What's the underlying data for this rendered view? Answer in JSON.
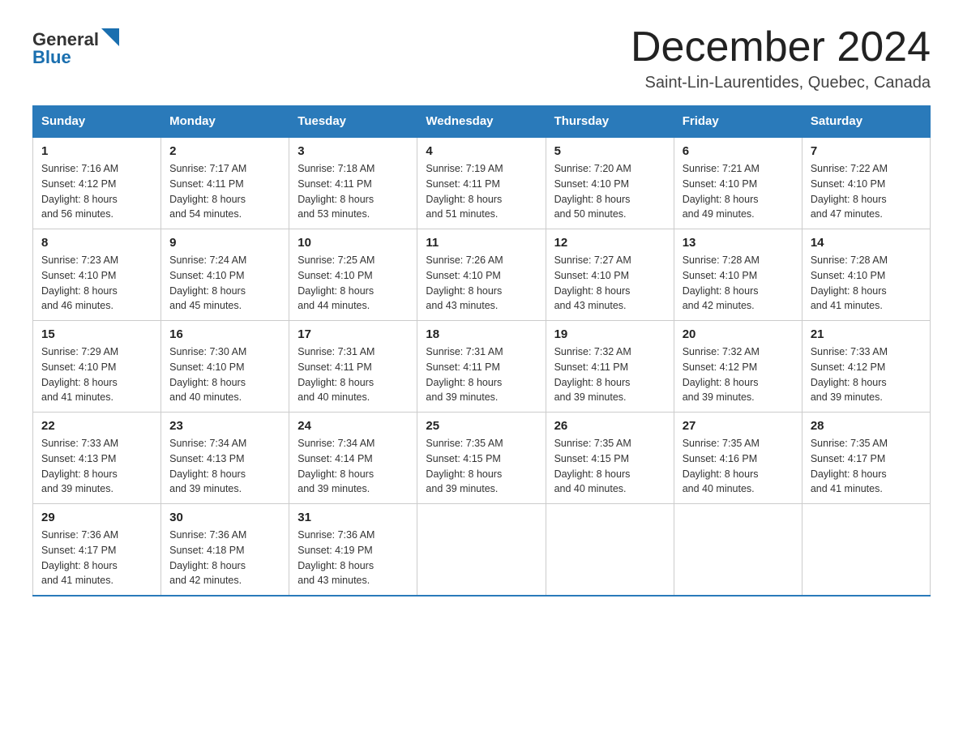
{
  "header": {
    "logo_general": "General",
    "logo_blue": "Blue",
    "title": "December 2024",
    "subtitle": "Saint-Lin-Laurentides, Quebec, Canada"
  },
  "calendar": {
    "days_of_week": [
      "Sunday",
      "Monday",
      "Tuesday",
      "Wednesday",
      "Thursday",
      "Friday",
      "Saturday"
    ],
    "weeks": [
      [
        {
          "day": "1",
          "sunrise": "Sunrise: 7:16 AM",
          "sunset": "Sunset: 4:12 PM",
          "daylight": "Daylight: 8 hours",
          "daylight2": "and 56 minutes."
        },
        {
          "day": "2",
          "sunrise": "Sunrise: 7:17 AM",
          "sunset": "Sunset: 4:11 PM",
          "daylight": "Daylight: 8 hours",
          "daylight2": "and 54 minutes."
        },
        {
          "day": "3",
          "sunrise": "Sunrise: 7:18 AM",
          "sunset": "Sunset: 4:11 PM",
          "daylight": "Daylight: 8 hours",
          "daylight2": "and 53 minutes."
        },
        {
          "day": "4",
          "sunrise": "Sunrise: 7:19 AM",
          "sunset": "Sunset: 4:11 PM",
          "daylight": "Daylight: 8 hours",
          "daylight2": "and 51 minutes."
        },
        {
          "day": "5",
          "sunrise": "Sunrise: 7:20 AM",
          "sunset": "Sunset: 4:10 PM",
          "daylight": "Daylight: 8 hours",
          "daylight2": "and 50 minutes."
        },
        {
          "day": "6",
          "sunrise": "Sunrise: 7:21 AM",
          "sunset": "Sunset: 4:10 PM",
          "daylight": "Daylight: 8 hours",
          "daylight2": "and 49 minutes."
        },
        {
          "day": "7",
          "sunrise": "Sunrise: 7:22 AM",
          "sunset": "Sunset: 4:10 PM",
          "daylight": "Daylight: 8 hours",
          "daylight2": "and 47 minutes."
        }
      ],
      [
        {
          "day": "8",
          "sunrise": "Sunrise: 7:23 AM",
          "sunset": "Sunset: 4:10 PM",
          "daylight": "Daylight: 8 hours",
          "daylight2": "and 46 minutes."
        },
        {
          "day": "9",
          "sunrise": "Sunrise: 7:24 AM",
          "sunset": "Sunset: 4:10 PM",
          "daylight": "Daylight: 8 hours",
          "daylight2": "and 45 minutes."
        },
        {
          "day": "10",
          "sunrise": "Sunrise: 7:25 AM",
          "sunset": "Sunset: 4:10 PM",
          "daylight": "Daylight: 8 hours",
          "daylight2": "and 44 minutes."
        },
        {
          "day": "11",
          "sunrise": "Sunrise: 7:26 AM",
          "sunset": "Sunset: 4:10 PM",
          "daylight": "Daylight: 8 hours",
          "daylight2": "and 43 minutes."
        },
        {
          "day": "12",
          "sunrise": "Sunrise: 7:27 AM",
          "sunset": "Sunset: 4:10 PM",
          "daylight": "Daylight: 8 hours",
          "daylight2": "and 43 minutes."
        },
        {
          "day": "13",
          "sunrise": "Sunrise: 7:28 AM",
          "sunset": "Sunset: 4:10 PM",
          "daylight": "Daylight: 8 hours",
          "daylight2": "and 42 minutes."
        },
        {
          "day": "14",
          "sunrise": "Sunrise: 7:28 AM",
          "sunset": "Sunset: 4:10 PM",
          "daylight": "Daylight: 8 hours",
          "daylight2": "and 41 minutes."
        }
      ],
      [
        {
          "day": "15",
          "sunrise": "Sunrise: 7:29 AM",
          "sunset": "Sunset: 4:10 PM",
          "daylight": "Daylight: 8 hours",
          "daylight2": "and 41 minutes."
        },
        {
          "day": "16",
          "sunrise": "Sunrise: 7:30 AM",
          "sunset": "Sunset: 4:10 PM",
          "daylight": "Daylight: 8 hours",
          "daylight2": "and 40 minutes."
        },
        {
          "day": "17",
          "sunrise": "Sunrise: 7:31 AM",
          "sunset": "Sunset: 4:11 PM",
          "daylight": "Daylight: 8 hours",
          "daylight2": "and 40 minutes."
        },
        {
          "day": "18",
          "sunrise": "Sunrise: 7:31 AM",
          "sunset": "Sunset: 4:11 PM",
          "daylight": "Daylight: 8 hours",
          "daylight2": "and 39 minutes."
        },
        {
          "day": "19",
          "sunrise": "Sunrise: 7:32 AM",
          "sunset": "Sunset: 4:11 PM",
          "daylight": "Daylight: 8 hours",
          "daylight2": "and 39 minutes."
        },
        {
          "day": "20",
          "sunrise": "Sunrise: 7:32 AM",
          "sunset": "Sunset: 4:12 PM",
          "daylight": "Daylight: 8 hours",
          "daylight2": "and 39 minutes."
        },
        {
          "day": "21",
          "sunrise": "Sunrise: 7:33 AM",
          "sunset": "Sunset: 4:12 PM",
          "daylight": "Daylight: 8 hours",
          "daylight2": "and 39 minutes."
        }
      ],
      [
        {
          "day": "22",
          "sunrise": "Sunrise: 7:33 AM",
          "sunset": "Sunset: 4:13 PM",
          "daylight": "Daylight: 8 hours",
          "daylight2": "and 39 minutes."
        },
        {
          "day": "23",
          "sunrise": "Sunrise: 7:34 AM",
          "sunset": "Sunset: 4:13 PM",
          "daylight": "Daylight: 8 hours",
          "daylight2": "and 39 minutes."
        },
        {
          "day": "24",
          "sunrise": "Sunrise: 7:34 AM",
          "sunset": "Sunset: 4:14 PM",
          "daylight": "Daylight: 8 hours",
          "daylight2": "and 39 minutes."
        },
        {
          "day": "25",
          "sunrise": "Sunrise: 7:35 AM",
          "sunset": "Sunset: 4:15 PM",
          "daylight": "Daylight: 8 hours",
          "daylight2": "and 39 minutes."
        },
        {
          "day": "26",
          "sunrise": "Sunrise: 7:35 AM",
          "sunset": "Sunset: 4:15 PM",
          "daylight": "Daylight: 8 hours",
          "daylight2": "and 40 minutes."
        },
        {
          "day": "27",
          "sunrise": "Sunrise: 7:35 AM",
          "sunset": "Sunset: 4:16 PM",
          "daylight": "Daylight: 8 hours",
          "daylight2": "and 40 minutes."
        },
        {
          "day": "28",
          "sunrise": "Sunrise: 7:35 AM",
          "sunset": "Sunset: 4:17 PM",
          "daylight": "Daylight: 8 hours",
          "daylight2": "and 41 minutes."
        }
      ],
      [
        {
          "day": "29",
          "sunrise": "Sunrise: 7:36 AM",
          "sunset": "Sunset: 4:17 PM",
          "daylight": "Daylight: 8 hours",
          "daylight2": "and 41 minutes."
        },
        {
          "day": "30",
          "sunrise": "Sunrise: 7:36 AM",
          "sunset": "Sunset: 4:18 PM",
          "daylight": "Daylight: 8 hours",
          "daylight2": "and 42 minutes."
        },
        {
          "day": "31",
          "sunrise": "Sunrise: 7:36 AM",
          "sunset": "Sunset: 4:19 PM",
          "daylight": "Daylight: 8 hours",
          "daylight2": "and 43 minutes."
        },
        null,
        null,
        null,
        null
      ]
    ]
  }
}
